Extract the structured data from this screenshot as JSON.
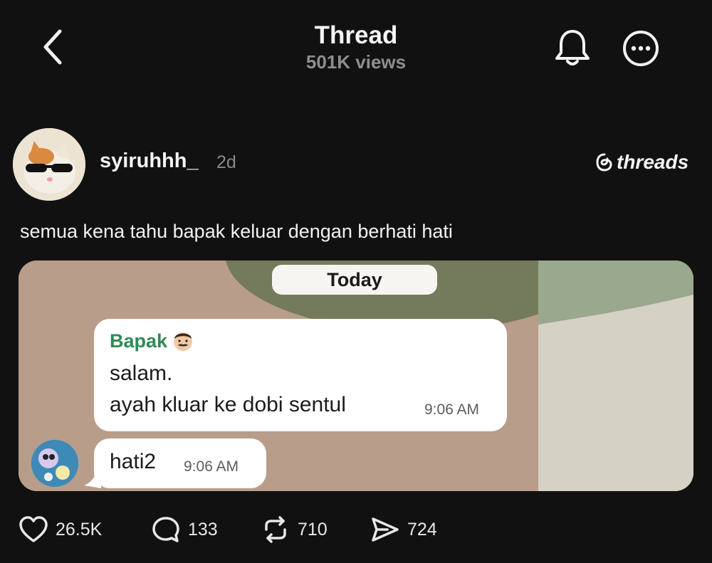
{
  "header": {
    "title": "Thread",
    "views": "501K views"
  },
  "post": {
    "username": "syiruhhh_",
    "time": "2d",
    "brand": "threads",
    "text": "semua kena tahu bapak keluar dengan berhati hati"
  },
  "chat_image": {
    "date_chip": "Today",
    "sender": "Bapak",
    "message_lines": [
      "salam.",
      "ayah kluar ke dobi sentul"
    ],
    "message_time": "9:06 AM",
    "reply": "hati2",
    "reply_time": "9:06 AM"
  },
  "actions": {
    "likes": "26.5K",
    "replies": "133",
    "reposts": "710",
    "shares": "724"
  },
  "icons": {
    "back": "chevron-left-icon",
    "bell": "bell-icon",
    "more": "more-circle-icon",
    "like": "heart-icon",
    "reply": "comment-icon",
    "repost": "repost-icon",
    "share": "send-icon"
  },
  "colors": {
    "background": "#111111",
    "sender_name": "#2f8a56",
    "muted": "#8e8e8e"
  }
}
